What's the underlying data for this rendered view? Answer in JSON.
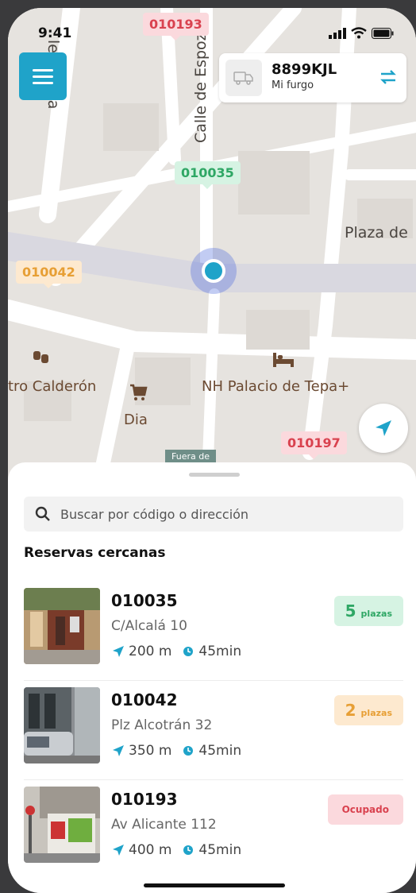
{
  "status_bar": {
    "time": "9:41"
  },
  "map": {
    "streets": {
      "arenas": "le Arrieta",
      "espoz": "Calle de Espoz",
      "plaza": "Plaza de",
      "teatro": "tro Calderón",
      "hotel": "NH Palacio de Tepa+",
      "dia": "Dia",
      "fuera": "Fuera de"
    },
    "markers": [
      {
        "code": "010193",
        "status": "red"
      },
      {
        "code": "010035",
        "status": "green"
      },
      {
        "code": "010042",
        "status": "orange"
      },
      {
        "code": "010197",
        "status": "red"
      }
    ]
  },
  "vehicle": {
    "plate": "8899KJL",
    "name": "Mi furgo"
  },
  "sheet": {
    "search_placeholder": "Buscar por código o dirección",
    "section_title": "Reservas cercanas",
    "items": [
      {
        "code": "010035",
        "address": "C/Alcalá 10",
        "distance": "200 m",
        "time": "45min",
        "badge_num": "5",
        "badge_unit": "plazas",
        "badge_status": "green"
      },
      {
        "code": "010042",
        "address": "Plz Alcotrán 32",
        "distance": "350 m",
        "time": "45min",
        "badge_num": "2",
        "badge_unit": "plazas",
        "badge_status": "orange"
      },
      {
        "code": "010193",
        "address": "Av Alicante 112",
        "distance": "400 m",
        "time": "45min",
        "badge_label": "Ocupado",
        "badge_status": "red"
      }
    ]
  },
  "colors": {
    "accent": "#1fa3c9",
    "green": "#2fa765",
    "orange": "#e79f35",
    "red": "#d9424f"
  }
}
